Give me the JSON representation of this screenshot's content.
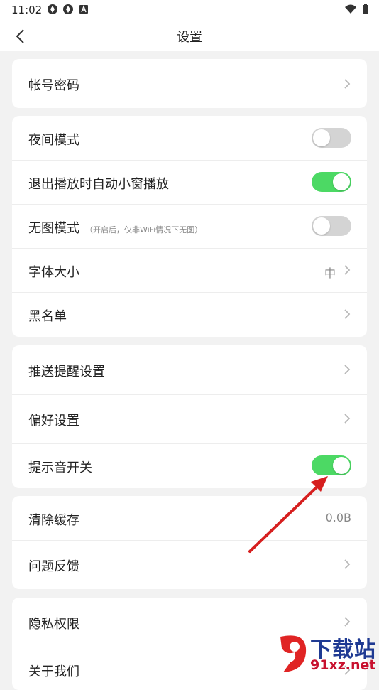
{
  "status_bar": {
    "time": "11:02",
    "icons": [
      "aperture-icon",
      "aperture-icon",
      "a-badge-icon",
      "wifi-icon",
      "battery-icon"
    ]
  },
  "nav": {
    "title": "设置",
    "back_icon": "chevron-left-icon"
  },
  "groups": [
    {
      "items": [
        {
          "label": "帐号密码",
          "control": "chevron"
        }
      ]
    },
    {
      "items": [
        {
          "label": "夜间模式",
          "control": "toggle",
          "on": false
        },
        {
          "label": "退出播放时自动小窗播放",
          "control": "toggle",
          "on": true
        },
        {
          "label": "无图模式",
          "note": "（开启后，仅非WiFi情况下无图）",
          "control": "toggle",
          "on": false
        },
        {
          "label": "字体大小",
          "value": "中",
          "control": "chevron"
        },
        {
          "label": "黑名单",
          "control": "chevron"
        }
      ]
    },
    {
      "items": [
        {
          "label": "推送提醒设置",
          "control": "chevron"
        },
        {
          "label": "偏好设置",
          "control": "chevron"
        },
        {
          "label": "提示音开关",
          "control": "toggle",
          "on": true
        }
      ]
    },
    {
      "items": [
        {
          "label": "清除缓存",
          "value": "0.0B",
          "control": "value"
        },
        {
          "label": "问题反馈",
          "control": "chevron"
        }
      ]
    },
    {
      "items": [
        {
          "label": "隐私权限",
          "control": "chevron"
        },
        {
          "label": "关于我们",
          "control": "chevron"
        }
      ]
    }
  ],
  "annotation": {
    "arrow_color": "#d61f1f"
  },
  "watermark": {
    "line1": "下载站",
    "line2": "91xz.net"
  },
  "colors": {
    "toggle_on": "#4cd964",
    "toggle_off": "#d4d4d4",
    "background": "#f2f2f2"
  }
}
